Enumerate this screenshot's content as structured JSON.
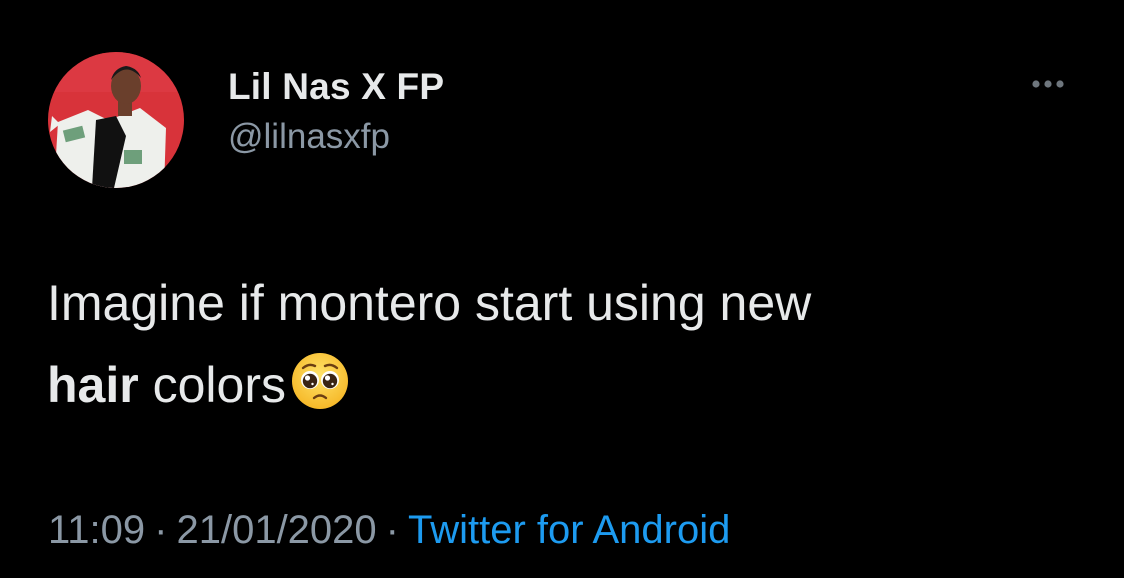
{
  "tweet": {
    "author": {
      "display_name": "Lil Nas X FP",
      "handle": "@lilnasxfp",
      "avatar_icon": "profile-photo"
    },
    "more_icon": "more-horizontal-icon",
    "text": {
      "line1": "Imagine if montero start using new",
      "bold_word": "hair",
      "rest": " colors",
      "emoji": "pleading-face-emoji"
    },
    "meta": {
      "time": "11:09",
      "separator": "·",
      "date": "21/01/2020",
      "source": "Twitter for Android"
    }
  },
  "colors": {
    "background": "#000000",
    "primary_text": "#e7e9ea",
    "secondary_text": "#8b98a5",
    "link": "#1d9bf0",
    "avatar_background": "#d8333a"
  }
}
